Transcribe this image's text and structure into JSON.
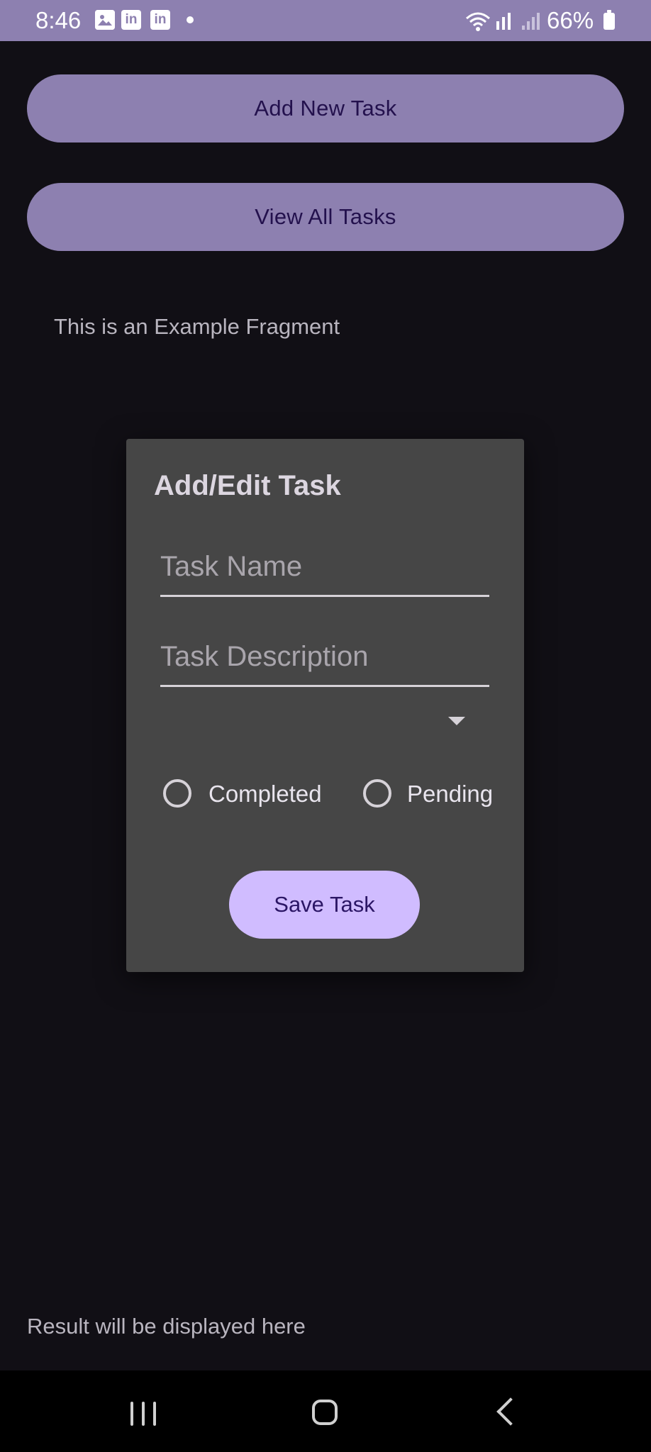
{
  "status_bar": {
    "time": "8:46",
    "notification_icons": [
      "gallery-icon",
      "linkedin-icon",
      "linkedin-icon"
    ],
    "battery": "66%"
  },
  "buttons": {
    "add_new_task": "Add New Task",
    "view_all_tasks": "View All Tasks"
  },
  "fragment_text": "This is an Example Fragment",
  "dialog": {
    "title": "Add/Edit Task",
    "task_name_placeholder": "Task Name",
    "task_description_placeholder": "Task Description",
    "spinner_value": "",
    "radio_completed": "Completed",
    "radio_pending": "Pending",
    "save_button": "Save Task"
  },
  "result_text": "Result will be displayed here",
  "colors": {
    "status_bar": "#8d80b0",
    "background": "#110f15",
    "dialog_bg": "#464646",
    "button_bg": "#8d80b0",
    "save_button_bg": "#d0bcff"
  }
}
